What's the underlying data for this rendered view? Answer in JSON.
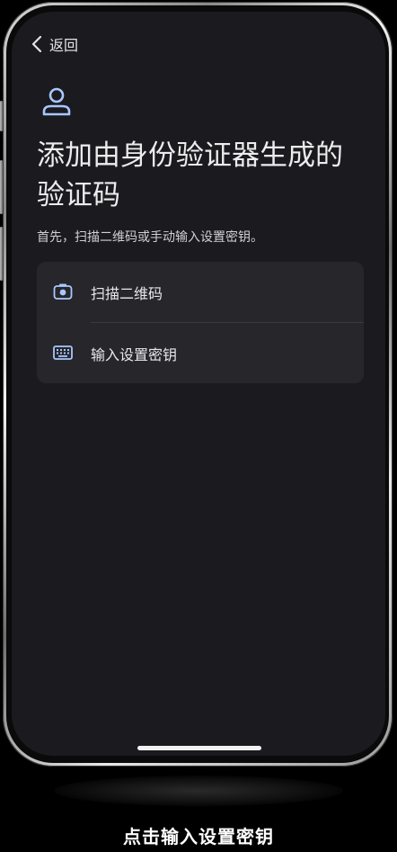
{
  "nav": {
    "back_label": "返回"
  },
  "page": {
    "title": "添加由身份验证器生成的验证码",
    "subtitle": "首先，扫描二维码或手动输入设置密钥。"
  },
  "options": [
    {
      "label": "扫描二维码",
      "icon": "camera-icon"
    },
    {
      "label": "输入设置密钥",
      "icon": "keyboard-icon"
    }
  ],
  "caption": "点击输入设置密钥",
  "colors": {
    "screen_bg": "#1b1b1f",
    "card_bg": "#26262b",
    "accent_icon": "#a9c7ff"
  }
}
